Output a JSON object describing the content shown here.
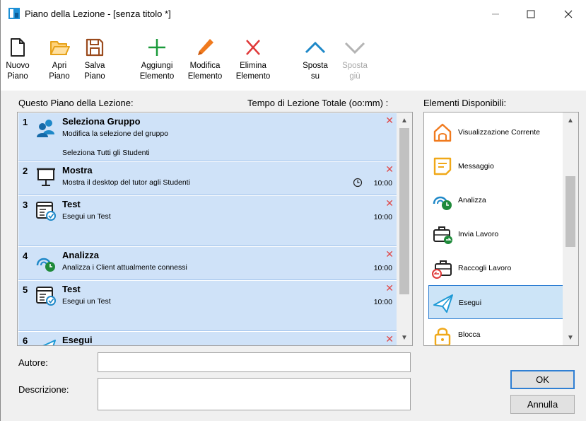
{
  "window": {
    "title": "Piano della Lezione - [senza titolo *]",
    "accent_color": "#1e90d6"
  },
  "toolbar": {
    "new_plan": {
      "line1": "Nuovo",
      "line2": "Piano",
      "icon": "document-icon"
    },
    "open_plan": {
      "line1": "Apri",
      "line2": "Piano",
      "icon": "folder-icon"
    },
    "save_plan": {
      "line1": "Salva",
      "line2": "Piano",
      "icon": "save-icon"
    },
    "add_element": {
      "line1": "Aggiungi",
      "line2": "Elemento",
      "icon": "plus-icon"
    },
    "edit_element": {
      "line1": "Modifica",
      "line2": "Elemento",
      "icon": "pencil-icon"
    },
    "delete_element": {
      "line1": "Elimina",
      "line2": "Elemento",
      "icon": "x-icon"
    },
    "move_up": {
      "line1": "Sposta",
      "line2": "su",
      "icon": "chevron-up-icon"
    },
    "move_down": {
      "line1": "Sposta",
      "line2": "giù",
      "icon": "chevron-down-icon",
      "disabled": true
    }
  },
  "labels": {
    "plan_list": "Questo Piano della Lezione:",
    "total_time": "Tempo di Lezione Totale (oo:mm) :",
    "available": "Elementi Disponibili:",
    "author": "Autore:",
    "description": "Descrizione:"
  },
  "plan_items": [
    {
      "num": "1",
      "title": "Seleziona Gruppo",
      "desc": "Modifica la selezione del gruppo",
      "desc2": "Seleziona Tutti gli Studenti",
      "time": "",
      "icon": "group-icon"
    },
    {
      "num": "2",
      "title": "Mostra",
      "desc": "Mostra il desktop del tutor agli Studenti",
      "time": "10:00",
      "icon": "presentation-icon",
      "has_clock": true
    },
    {
      "num": "3",
      "title": "Test",
      "desc": "Esegui un Test",
      "time": "10:00",
      "icon": "test-icon"
    },
    {
      "num": "4",
      "title": "Analizza",
      "desc": "Analizza i Client attualmente connessi",
      "time": "10:00",
      "icon": "analyze-icon"
    },
    {
      "num": "5",
      "title": "Test",
      "desc": "Esegui un Test",
      "time": "10:00",
      "icon": "test-icon"
    },
    {
      "num": "6",
      "title": "Esegui",
      "desc": "",
      "time": "",
      "icon": "send-icon"
    }
  ],
  "available_items": [
    {
      "label": "Visualizzazione Corrente",
      "icon": "home-view-icon"
    },
    {
      "label": "Messaggio",
      "icon": "message-icon"
    },
    {
      "label": "Analizza",
      "icon": "analyze-icon"
    },
    {
      "label": "Invia Lavoro",
      "icon": "send-work-icon"
    },
    {
      "label": "Raccogli Lavoro",
      "icon": "collect-work-icon"
    },
    {
      "label": "Esegui",
      "icon": "send-icon",
      "selected": true
    },
    {
      "label": "Blocca",
      "icon": "lock-icon"
    }
  ],
  "fields": {
    "author_value": "",
    "description_value": ""
  },
  "buttons": {
    "ok": "OK",
    "cancel": "Annulla"
  }
}
